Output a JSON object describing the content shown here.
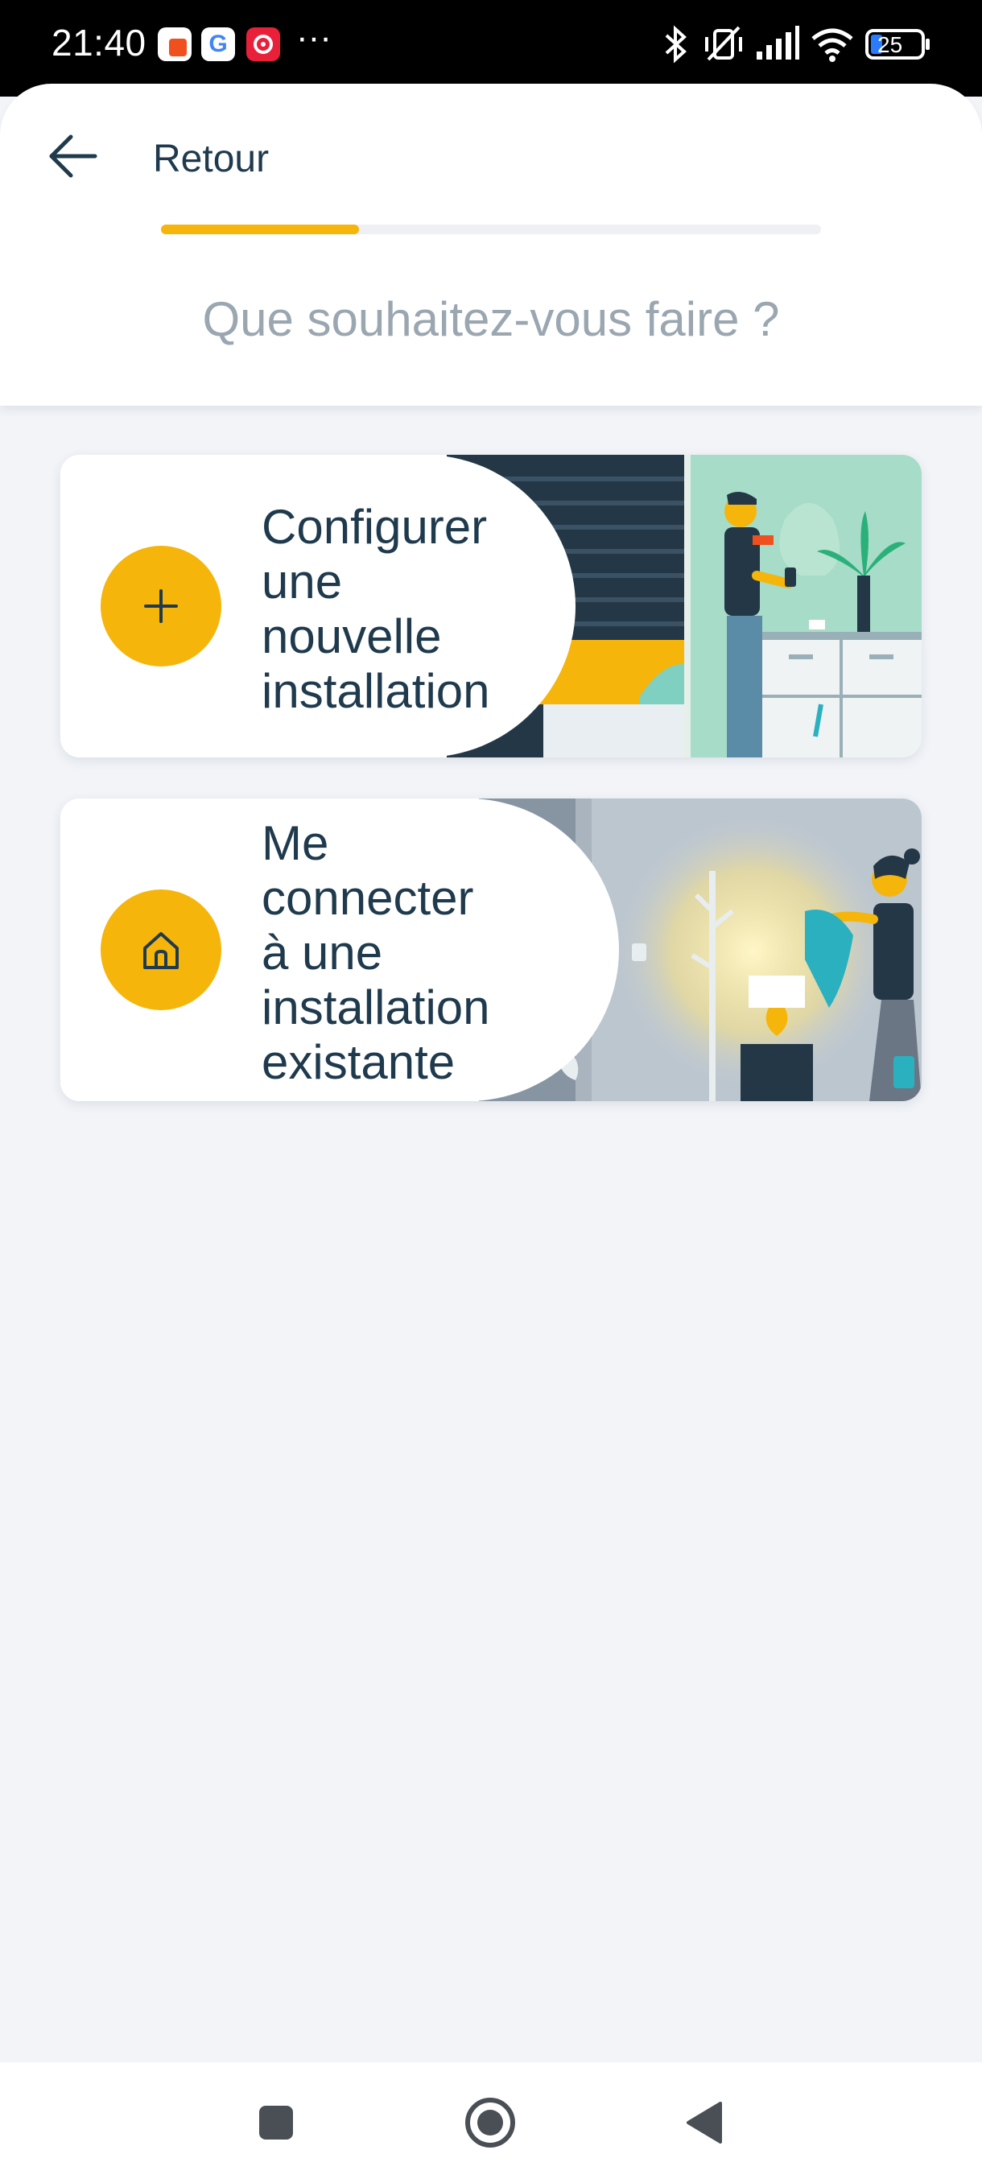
{
  "status_bar": {
    "time": "21:40",
    "battery": "25",
    "icons": [
      "bluetooth-icon",
      "vibrate-icon",
      "signal-icon",
      "wifi-icon",
      "battery-icon"
    ]
  },
  "header": {
    "back_label": "Retour",
    "progress": 0.3,
    "question": "Que souhaitez-vous faire ?"
  },
  "options": [
    {
      "label_lines": [
        "Configurer",
        "une",
        "nouvelle",
        "installation"
      ],
      "icon": "plus-icon"
    },
    {
      "label_lines": [
        "Me",
        "connecter",
        "à une",
        "installation",
        "existante"
      ],
      "icon": "home-icon"
    }
  ],
  "colors": {
    "accent": "#f5b50a",
    "text_dark": "#1f3a4d",
    "text_muted": "#9aa6b0",
    "background": "#f2f4f8"
  }
}
